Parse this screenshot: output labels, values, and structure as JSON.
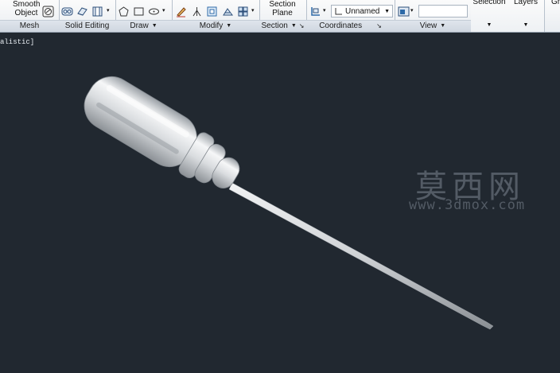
{
  "ribbon": {
    "panels": {
      "mesh": {
        "title": "Mesh",
        "smooth_line1": "Smooth",
        "smooth_line2": "Object"
      },
      "solid_editing": {
        "title": "Solid Editing"
      },
      "draw": {
        "title": "Draw"
      },
      "modify": {
        "title": "Modify"
      },
      "section": {
        "title": "Section",
        "btn_line1": "Section",
        "btn_line2": "Plane"
      },
      "coordinates": {
        "title": "Coordinates",
        "ucs_value": "Unnamed"
      },
      "view": {
        "title": "View"
      },
      "selection": {
        "label": "Selection"
      },
      "layers": {
        "label": "Layers"
      },
      "groups": {
        "label": "Gr"
      }
    }
  },
  "viewport": {
    "label": "alistic]",
    "watermark_cn": "莫西网",
    "watermark_url": "www.3dmox.com"
  },
  "colors": {
    "background": "#212830",
    "ribbon": "#eef1f4",
    "panel_title": "#d6dde5"
  }
}
